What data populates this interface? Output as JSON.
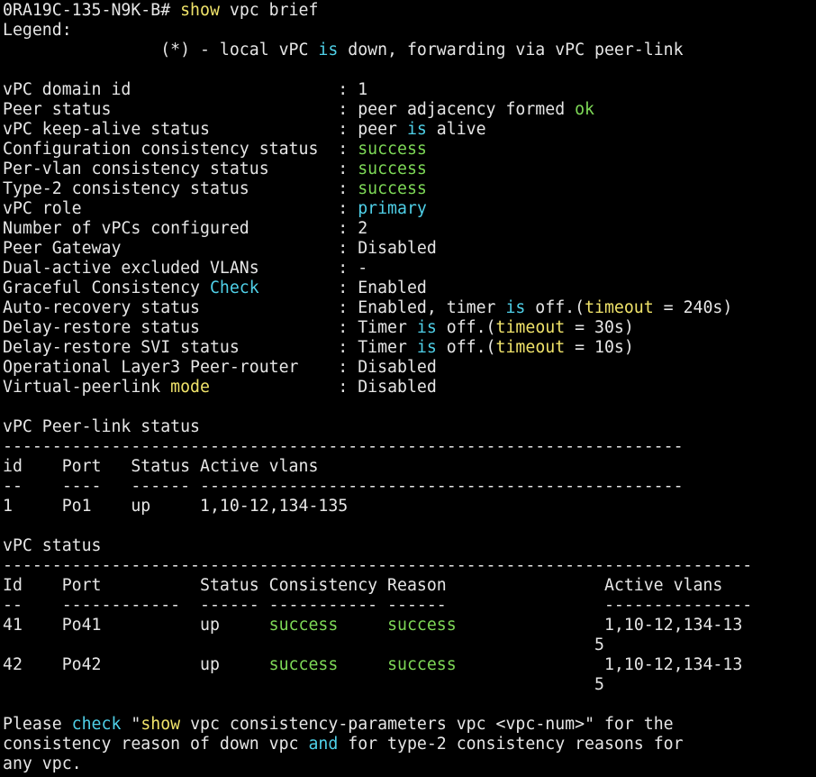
{
  "terminal": {
    "colors": {
      "background": "#000000",
      "text": "#e6e6e6",
      "green": "#7ed957",
      "cyan": "#4fd0e8",
      "yellow": "#f0e36a"
    },
    "lines": [
      [
        {
          "t": "0RA19C-135-N9K-B# ",
          "c": "w"
        },
        {
          "t": "show",
          "c": "y"
        },
        {
          "t": " vpc brief",
          "c": "w"
        }
      ],
      [
        {
          "t": "Legend:",
          "c": "w"
        }
      ],
      [
        {
          "t": "                (*) - local vPC ",
          "c": "w"
        },
        {
          "t": "is",
          "c": "c"
        },
        {
          "t": " down, forwarding via vPC peer-link",
          "c": "w"
        }
      ],
      [],
      [
        {
          "t": "vPC domain id                     : 1",
          "c": "w"
        }
      ],
      [
        {
          "t": "Peer status                       : peer adjacency formed ",
          "c": "w"
        },
        {
          "t": "ok",
          "c": "g"
        }
      ],
      [
        {
          "t": "vPC keep-alive status             : peer ",
          "c": "w"
        },
        {
          "t": "is",
          "c": "c"
        },
        {
          "t": " alive",
          "c": "w"
        }
      ],
      [
        {
          "t": "Configuration consistency status  : ",
          "c": "w"
        },
        {
          "t": "success",
          "c": "g"
        }
      ],
      [
        {
          "t": "Per-vlan consistency status       : ",
          "c": "w"
        },
        {
          "t": "success",
          "c": "g"
        }
      ],
      [
        {
          "t": "Type-2 consistency status         : ",
          "c": "w"
        },
        {
          "t": "success",
          "c": "g"
        }
      ],
      [
        {
          "t": "vPC role                          : ",
          "c": "w"
        },
        {
          "t": "primary",
          "c": "c"
        }
      ],
      [
        {
          "t": "Number of vPCs configured         : 2",
          "c": "w"
        }
      ],
      [
        {
          "t": "Peer Gateway                      : Disabled",
          "c": "w"
        }
      ],
      [
        {
          "t": "Dual-active excluded VLANs        : -",
          "c": "w"
        }
      ],
      [
        {
          "t": "Graceful Consistency ",
          "c": "w"
        },
        {
          "t": "Check",
          "c": "c"
        },
        {
          "t": "        : Enabled",
          "c": "w"
        }
      ],
      [
        {
          "t": "Auto-recovery status              : Enabled, timer ",
          "c": "w"
        },
        {
          "t": "is",
          "c": "c"
        },
        {
          "t": " off.(",
          "c": "w"
        },
        {
          "t": "timeout",
          "c": "y"
        },
        {
          "t": " = 240s)",
          "c": "w"
        }
      ],
      [
        {
          "t": "Delay-restore status              : Timer ",
          "c": "w"
        },
        {
          "t": "is",
          "c": "c"
        },
        {
          "t": " off.(",
          "c": "w"
        },
        {
          "t": "timeout",
          "c": "y"
        },
        {
          "t": " = 30s)",
          "c": "w"
        }
      ],
      [
        {
          "t": "Delay-restore SVI status          : Timer ",
          "c": "w"
        },
        {
          "t": "is",
          "c": "c"
        },
        {
          "t": " off.(",
          "c": "w"
        },
        {
          "t": "timeout",
          "c": "y"
        },
        {
          "t": " = 10s)",
          "c": "w"
        }
      ],
      [
        {
          "t": "Operational Layer3 Peer-router    : Disabled",
          "c": "w"
        }
      ],
      [
        {
          "t": "Virtual-peerlink ",
          "c": "w"
        },
        {
          "t": "mode",
          "c": "y"
        },
        {
          "t": "             : Disabled",
          "c": "w"
        }
      ],
      [],
      [
        {
          "t": "vPC Peer-link status",
          "c": "w"
        }
      ],
      [
        {
          "t": "---------------------------------------------------------------------",
          "c": "w"
        }
      ],
      [
        {
          "t": "id    Port   Status Active vlans",
          "c": "w"
        }
      ],
      [
        {
          "t": "--    ----   ------ -------------------------------------------------",
          "c": "w"
        }
      ],
      [
        {
          "t": "1     Po1    up     1,10-12,134-135",
          "c": "w"
        }
      ],
      [],
      [
        {
          "t": "vPC status",
          "c": "w"
        }
      ],
      [
        {
          "t": "----------------------------------------------------------------------------",
          "c": "w"
        }
      ],
      [
        {
          "t": "Id    Port          Status Consistency Reason                Active vlans",
          "c": "w"
        }
      ],
      [
        {
          "t": "--    ------------  ------ ----------- ------                ---------------",
          "c": "w"
        }
      ],
      [
        {
          "t": "41    Po41          up     ",
          "c": "w"
        },
        {
          "t": "success",
          "c": "g"
        },
        {
          "t": "     ",
          "c": "w"
        },
        {
          "t": "success",
          "c": "g"
        },
        {
          "t": "               1,10-12,134-13",
          "c": "w"
        }
      ],
      [
        {
          "t": "                                                            5",
          "c": "w"
        }
      ],
      [
        {
          "t": "42    Po42          up     ",
          "c": "w"
        },
        {
          "t": "success",
          "c": "g"
        },
        {
          "t": "     ",
          "c": "w"
        },
        {
          "t": "success",
          "c": "g"
        },
        {
          "t": "               1,10-12,134-13",
          "c": "w"
        }
      ],
      [
        {
          "t": "                                                            5",
          "c": "w"
        }
      ],
      [],
      [
        {
          "t": "Please ",
          "c": "w"
        },
        {
          "t": "check",
          "c": "c"
        },
        {
          "t": " \"",
          "c": "w"
        },
        {
          "t": "show",
          "c": "y"
        },
        {
          "t": " vpc consistency-parameters vpc <vpc-num>\" for the",
          "c": "w"
        }
      ],
      [
        {
          "t": "consistency reason of down vpc ",
          "c": "w"
        },
        {
          "t": "and",
          "c": "c"
        },
        {
          "t": " for type-2 consistency reasons for",
          "c": "w"
        }
      ],
      [
        {
          "t": "any vpc.",
          "c": "w"
        }
      ]
    ]
  }
}
